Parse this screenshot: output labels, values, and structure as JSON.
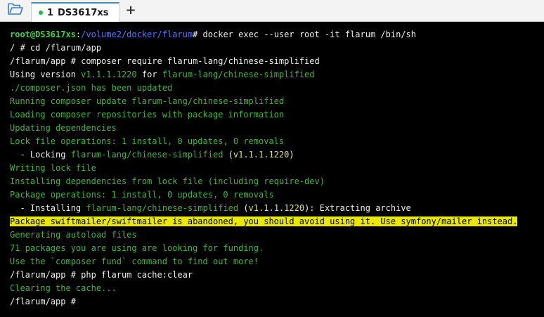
{
  "tabbar": {
    "tab": {
      "number": "1",
      "title": "DS3617xs"
    },
    "add_label": "+"
  },
  "terminal": {
    "line1": {
      "user_host": "root@DS3617xs",
      "colon": ":",
      "path": "/volume2/docker/flarum",
      "cmd": "# docker exec --user root -it flarum /bin/sh"
    },
    "line2": "/ # cd /flarum/app",
    "line3": "/flarum/app # composer require flarum-lang/chinese-simplified",
    "line4": {
      "a": "Using version ",
      "version": "v1.1.1.1220",
      "b": " for ",
      "pkg": "flarum-lang/chinese-simplified"
    },
    "line5": "./composer.json has been updated",
    "line6": "Running composer update flarum-lang/chinese-simplified",
    "line7": "Loading composer repositories with package information",
    "line8": "Updating dependencies",
    "line9": "Lock file operations: 1 install, 0 updates, 0 removals",
    "line10": {
      "a": "  - Locking ",
      "pkg": "flarum-lang/chinese-simplified",
      "b": " (",
      "version": "v1.1.1.1220",
      "c": ")"
    },
    "line11": "Writing lock file",
    "line12": "Installing dependencies from lock file (including require-dev)",
    "line13": "Package operations: 1 install, 0 updates, 0 removals",
    "line14": {
      "a": "  - Installing ",
      "pkg": "flarum-lang/chinese-simplified",
      "b": " (",
      "version": "v1.1.1.1220",
      "c": "): Extracting archive"
    },
    "line15": "Package swiftmailer/swiftmailer is abandoned, you should avoid using it. Use symfony/mailer instead.",
    "line16": "Generating autoload files",
    "line17": "71 packages you are using are looking for funding.",
    "line18": "Use the `composer fund` command to find out more!",
    "line19": "/flarum/app # php flarum cache:clear",
    "line20": "Clearing the cache...",
    "line21": "/flarum/app # "
  },
  "colors": {
    "background": "#000000",
    "green_output": "#3fb73f",
    "prompt_user": "#41d441",
    "prompt_path": "#4f7bff",
    "version": "#e6e64a",
    "warning_bg": "#e8e800",
    "tab_accent": "#3a8fd8",
    "tab_dot": "#27b34a"
  }
}
